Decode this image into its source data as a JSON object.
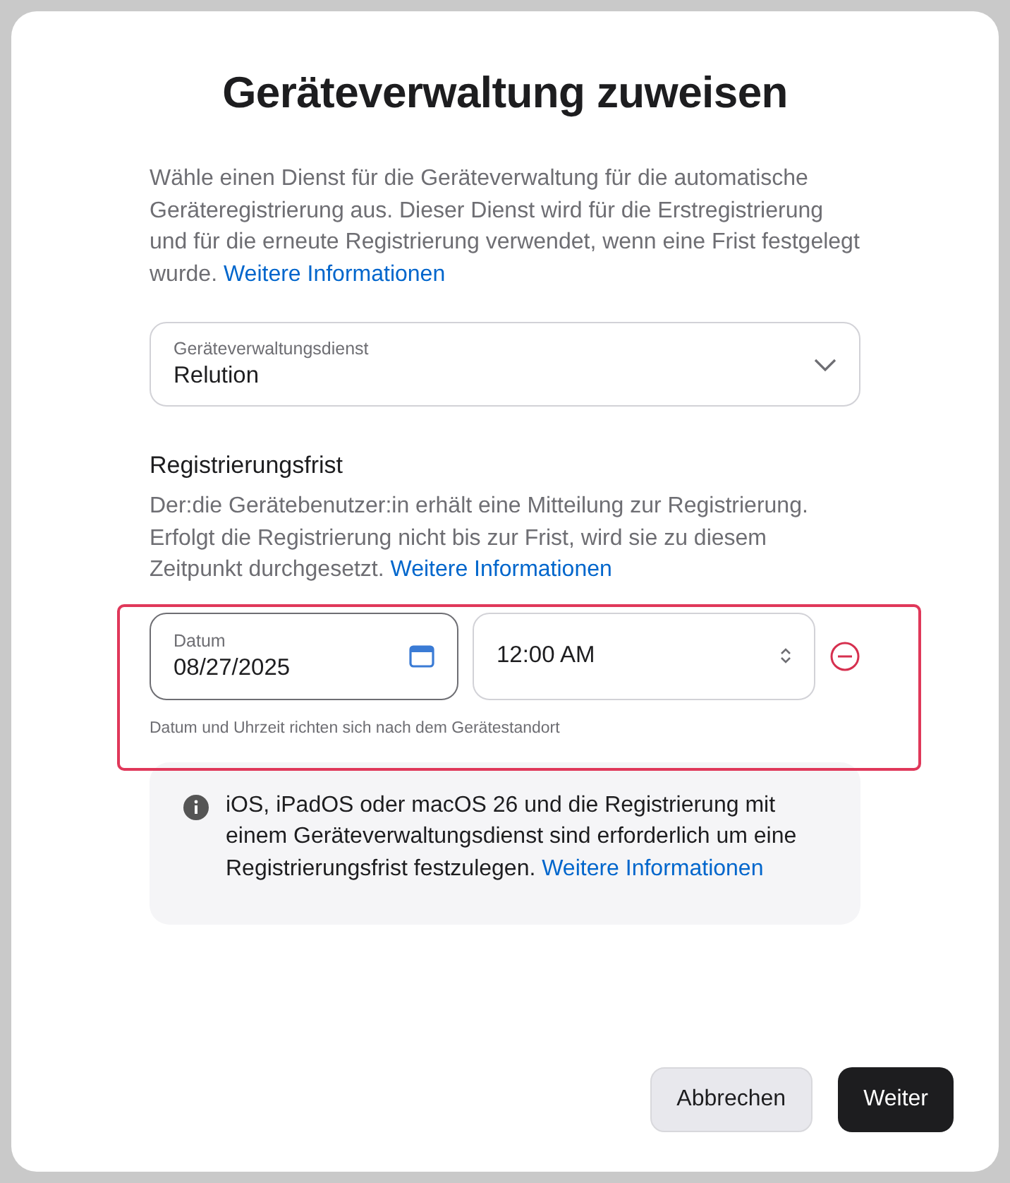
{
  "dialog": {
    "title": "Geräteverwaltung zuweisen",
    "intro": {
      "text": "Wähle einen Dienst für die Geräteverwaltung für die automatische Geräteregistrierung aus. Dieser Dienst wird für die Erstregistrierung und für die erneute Registrierung verwendet, wenn eine Frist festgelegt wurde.",
      "link": "Weitere Informationen"
    },
    "service_select": {
      "label": "Geräteverwaltungsdienst",
      "value": "Relution"
    },
    "deadline": {
      "heading": "Registrierungsfrist",
      "text": "Der:die Gerätebenutzer:in erhält eine Mitteilung zur Registrierung. Erfolgt die Registrierung nicht bis zur Frist, wird sie zu diesem Zeitpunkt durchgesetzt.",
      "link": "Weitere Informationen",
      "date_field": {
        "label": "Datum",
        "value": "08/27/2025"
      },
      "time_field": {
        "value": "12:00 AM"
      },
      "hint": "Datum und Uhrzeit richten sich nach dem Gerätestandort",
      "highlighted": true
    },
    "notice": {
      "text": "iOS, iPadOS oder macOS 26 und die Registrierung mit einem Geräteverwaltungsdienst sind erforderlich um eine Registrierungsfrist festzulegen.",
      "link": "Weitere Informationen"
    },
    "buttons": [
      {
        "label": "Abbrechen",
        "kind": "secondary"
      },
      {
        "label": "Weiter",
        "kind": "primary"
      }
    ]
  }
}
